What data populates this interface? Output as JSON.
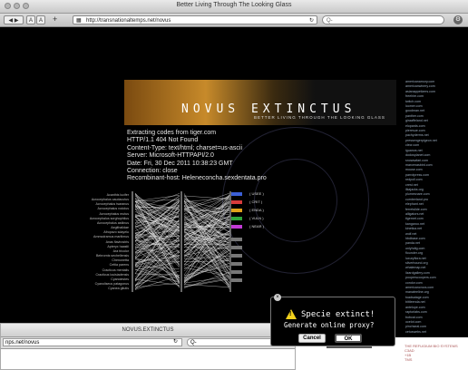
{
  "main_window": {
    "title": "Better Living Through The Looking Glass",
    "url": "http://transnationaltemps.net/novus",
    "search_placeholder": "Q-"
  },
  "banner": {
    "logo": "NOVUS EXTINCTUS",
    "tagline": "BETTER LIVING THROUGH THE LOOKING GLASS"
  },
  "http_response": [
    "Extracting codes from tiger.com",
    "HTTP/1.1 404 Not Found",
    "Content-Type: text/html; charset=us-ascii",
    "Server: Microsoft-HTTPAPI/2.0",
    "Date: Fri, 30 Dec 2011 10:38:23 GMT",
    "Connection: close",
    "Recombinant-host: Heleneconcha.sexdentata.pro"
  ],
  "species": [
    "Acanthis lucifer",
    "Acrocephalus caudacutus",
    "Acrocephalus tsaranus",
    "Acrocephalus rodolus",
    "Acrocephalus mutus",
    "Acrocephalus sorghophilus",
    "Acrocephalus astiinus",
    "Aegithalidae",
    "Afropavo sdayelu",
    "Ammodramus maritimus",
    "Anas flavirostris",
    "Apteryx haastii",
    "Ara tricolor",
    "Bebrornis sechellensis",
    "Chenonetta",
    "Cettia parens",
    "Cracticus mentalis",
    "Cracticus louisiadensis",
    "Cyanolestes",
    "Cyanoliseus patagonus",
    "Cyanea gitutis"
  ],
  "legend": [
    {
      "label": "USEE",
      "color": "#3b5fd6"
    },
    {
      "label": "CRIT",
      "color": "#d63b3b"
    },
    {
      "label": "ENDA",
      "color": "#e0a21b"
    },
    {
      "label": "VULN",
      "color": "#2fa53b"
    },
    {
      "label": "NEAR",
      "color": "#c23bd6"
    }
  ],
  "domains": [
    "americanamory.com",
    "americanwinery.com",
    "asianappetizers.com",
    "freehire.com",
    "twitch.com",
    "loomer.com",
    "goodman.net",
    "panther.com",
    "giraaffeland.net",
    "elopards.com",
    "pieresue.com",
    "pachyderms.net",
    "pressengerpigeon.net",
    "clecr.com",
    "iguanos.net",
    "dodosplanet.com",
    "snowsafari.com",
    "marcenasbird.com",
    "mouse.com",
    "parrotpress.com",
    "redpoll.com",
    "crest.net",
    "ilkajacks.org",
    "plumesnare.com",
    "cumberland.pro",
    "elephant.net",
    "ferretslide.com",
    "alligators.net",
    "tigernet.com",
    "kangaroo.net",
    "kinetica.net",
    "wolf.net",
    "hbdbase.com",
    "panda.net",
    "onlyhdtg.com",
    "flounder.org",
    "luxuryflora.net",
    "silverhound.org",
    "whalemap.net",
    "lizardgallery.com",
    "pooperscoopers.com",
    "condor.com",
    "americancrocs.com",
    "manateeline.org",
    "toadsatage.com",
    "bittleenda.net",
    "antelope.com",
    "raptorlabs.com",
    "bobcat.com",
    "ocelot.com",
    "pinchseal.com",
    "cetuswebs.net"
  ],
  "dialog": {
    "title": "Specie extinct!",
    "message": "Generate online proxy?",
    "cancel_label": "Cancel",
    "ok_label": "OK",
    "close_glyph": "×"
  },
  "second_window": {
    "title": "NOVUS.EXTINCTUS",
    "url": "nps.net/novus",
    "search_placeholder": "Q-"
  },
  "corner_text": [
    "THE REFUGIUM BIO SYSTEMS",
    "C3AD",
    "+1B",
    "TMS"
  ]
}
